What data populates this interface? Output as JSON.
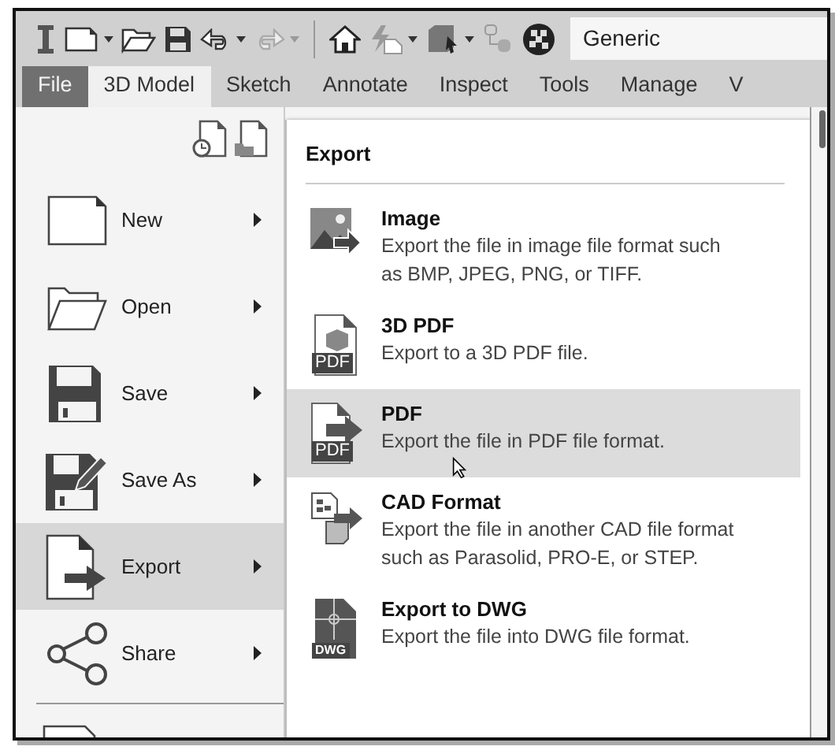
{
  "toolbar": {
    "material": "Generic"
  },
  "tabs": [
    {
      "label": "File",
      "kind": "file",
      "selected": false
    },
    {
      "label": "3D Model",
      "kind": "tab",
      "selected": true
    },
    {
      "label": "Sketch",
      "kind": "tab",
      "selected": false
    },
    {
      "label": "Annotate",
      "kind": "tab",
      "selected": false
    },
    {
      "label": "Inspect",
      "kind": "tab",
      "selected": false
    },
    {
      "label": "Tools",
      "kind": "tab",
      "selected": false
    },
    {
      "label": "Manage",
      "kind": "tab",
      "selected": false
    },
    {
      "label": "V",
      "kind": "tab",
      "selected": false
    }
  ],
  "file_menu": {
    "items": [
      {
        "label": "New",
        "kind": "new",
        "selected": false
      },
      {
        "label": "Open",
        "kind": "open",
        "selected": false
      },
      {
        "label": "Save",
        "kind": "save",
        "selected": false
      },
      {
        "label": "Save As",
        "kind": "saveas",
        "selected": false
      },
      {
        "label": "Export",
        "kind": "export",
        "selected": true
      },
      {
        "label": "Share",
        "kind": "share",
        "selected": false
      }
    ]
  },
  "export_panel": {
    "title": "Export",
    "items": [
      {
        "kind": "image",
        "title": "Image",
        "description": "Export the file in image file format such as BMP, JPEG, PNG, or TIFF.",
        "selected": false
      },
      {
        "kind": "pdf3d",
        "badge": "PDF",
        "title": "3D PDF",
        "description": "Export to a 3D PDF file.",
        "selected": false
      },
      {
        "kind": "pdf",
        "badge": "PDF",
        "title": "PDF",
        "description": "Export the file in PDF file format.",
        "selected": true
      },
      {
        "kind": "cad",
        "title": "CAD Format",
        "description": "Export the file in another CAD file format such as Parasolid, PRO-E, or STEP.",
        "selected": false
      },
      {
        "kind": "dwg",
        "badge": "DWG",
        "title": "Export to DWG",
        "description": "Export the file into DWG file format.",
        "selected": false
      }
    ]
  }
}
